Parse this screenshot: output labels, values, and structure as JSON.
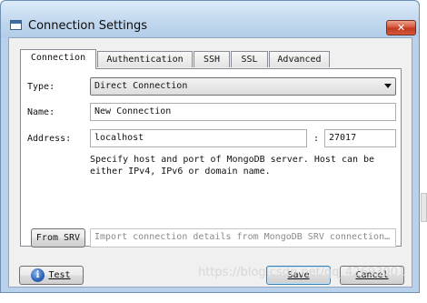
{
  "window": {
    "title": "Connection Settings",
    "close_glyph": "✕"
  },
  "tabs": [
    {
      "label": "Connection",
      "active": true
    },
    {
      "label": "Authentication",
      "active": false
    },
    {
      "label": "SSH",
      "active": false
    },
    {
      "label": "SSL",
      "active": false
    },
    {
      "label": "Advanced",
      "active": false
    }
  ],
  "form": {
    "type_label": "Type:",
    "type_value": "Direct Connection",
    "name_label": "Name:",
    "name_value": "New Connection",
    "address_label": "Address:",
    "host_value": "localhost",
    "port_separator": ":",
    "port_value": "27017",
    "help_text": "Specify host and port of MongoDB server. Host can be either IPv4, IPv6 or domain name."
  },
  "srv": {
    "button_label": "From SRV",
    "placeholder": "Import connection details from MongoDB SRV connection…"
  },
  "footer": {
    "test_label": "Test",
    "save_label": "Save",
    "cancel_label": "Cancel"
  },
  "watermark": "https://blog.csdn.net/qq_42693001",
  "colors": {
    "frame": "#b9d1ea",
    "close_button": "#d2573b",
    "client_area": "#f0f0f0",
    "default_button_border": "#3c7fb1"
  },
  "icons": [
    "window-app-icon",
    "close-icon",
    "dropdown-arrow-icon",
    "info-icon"
  ]
}
